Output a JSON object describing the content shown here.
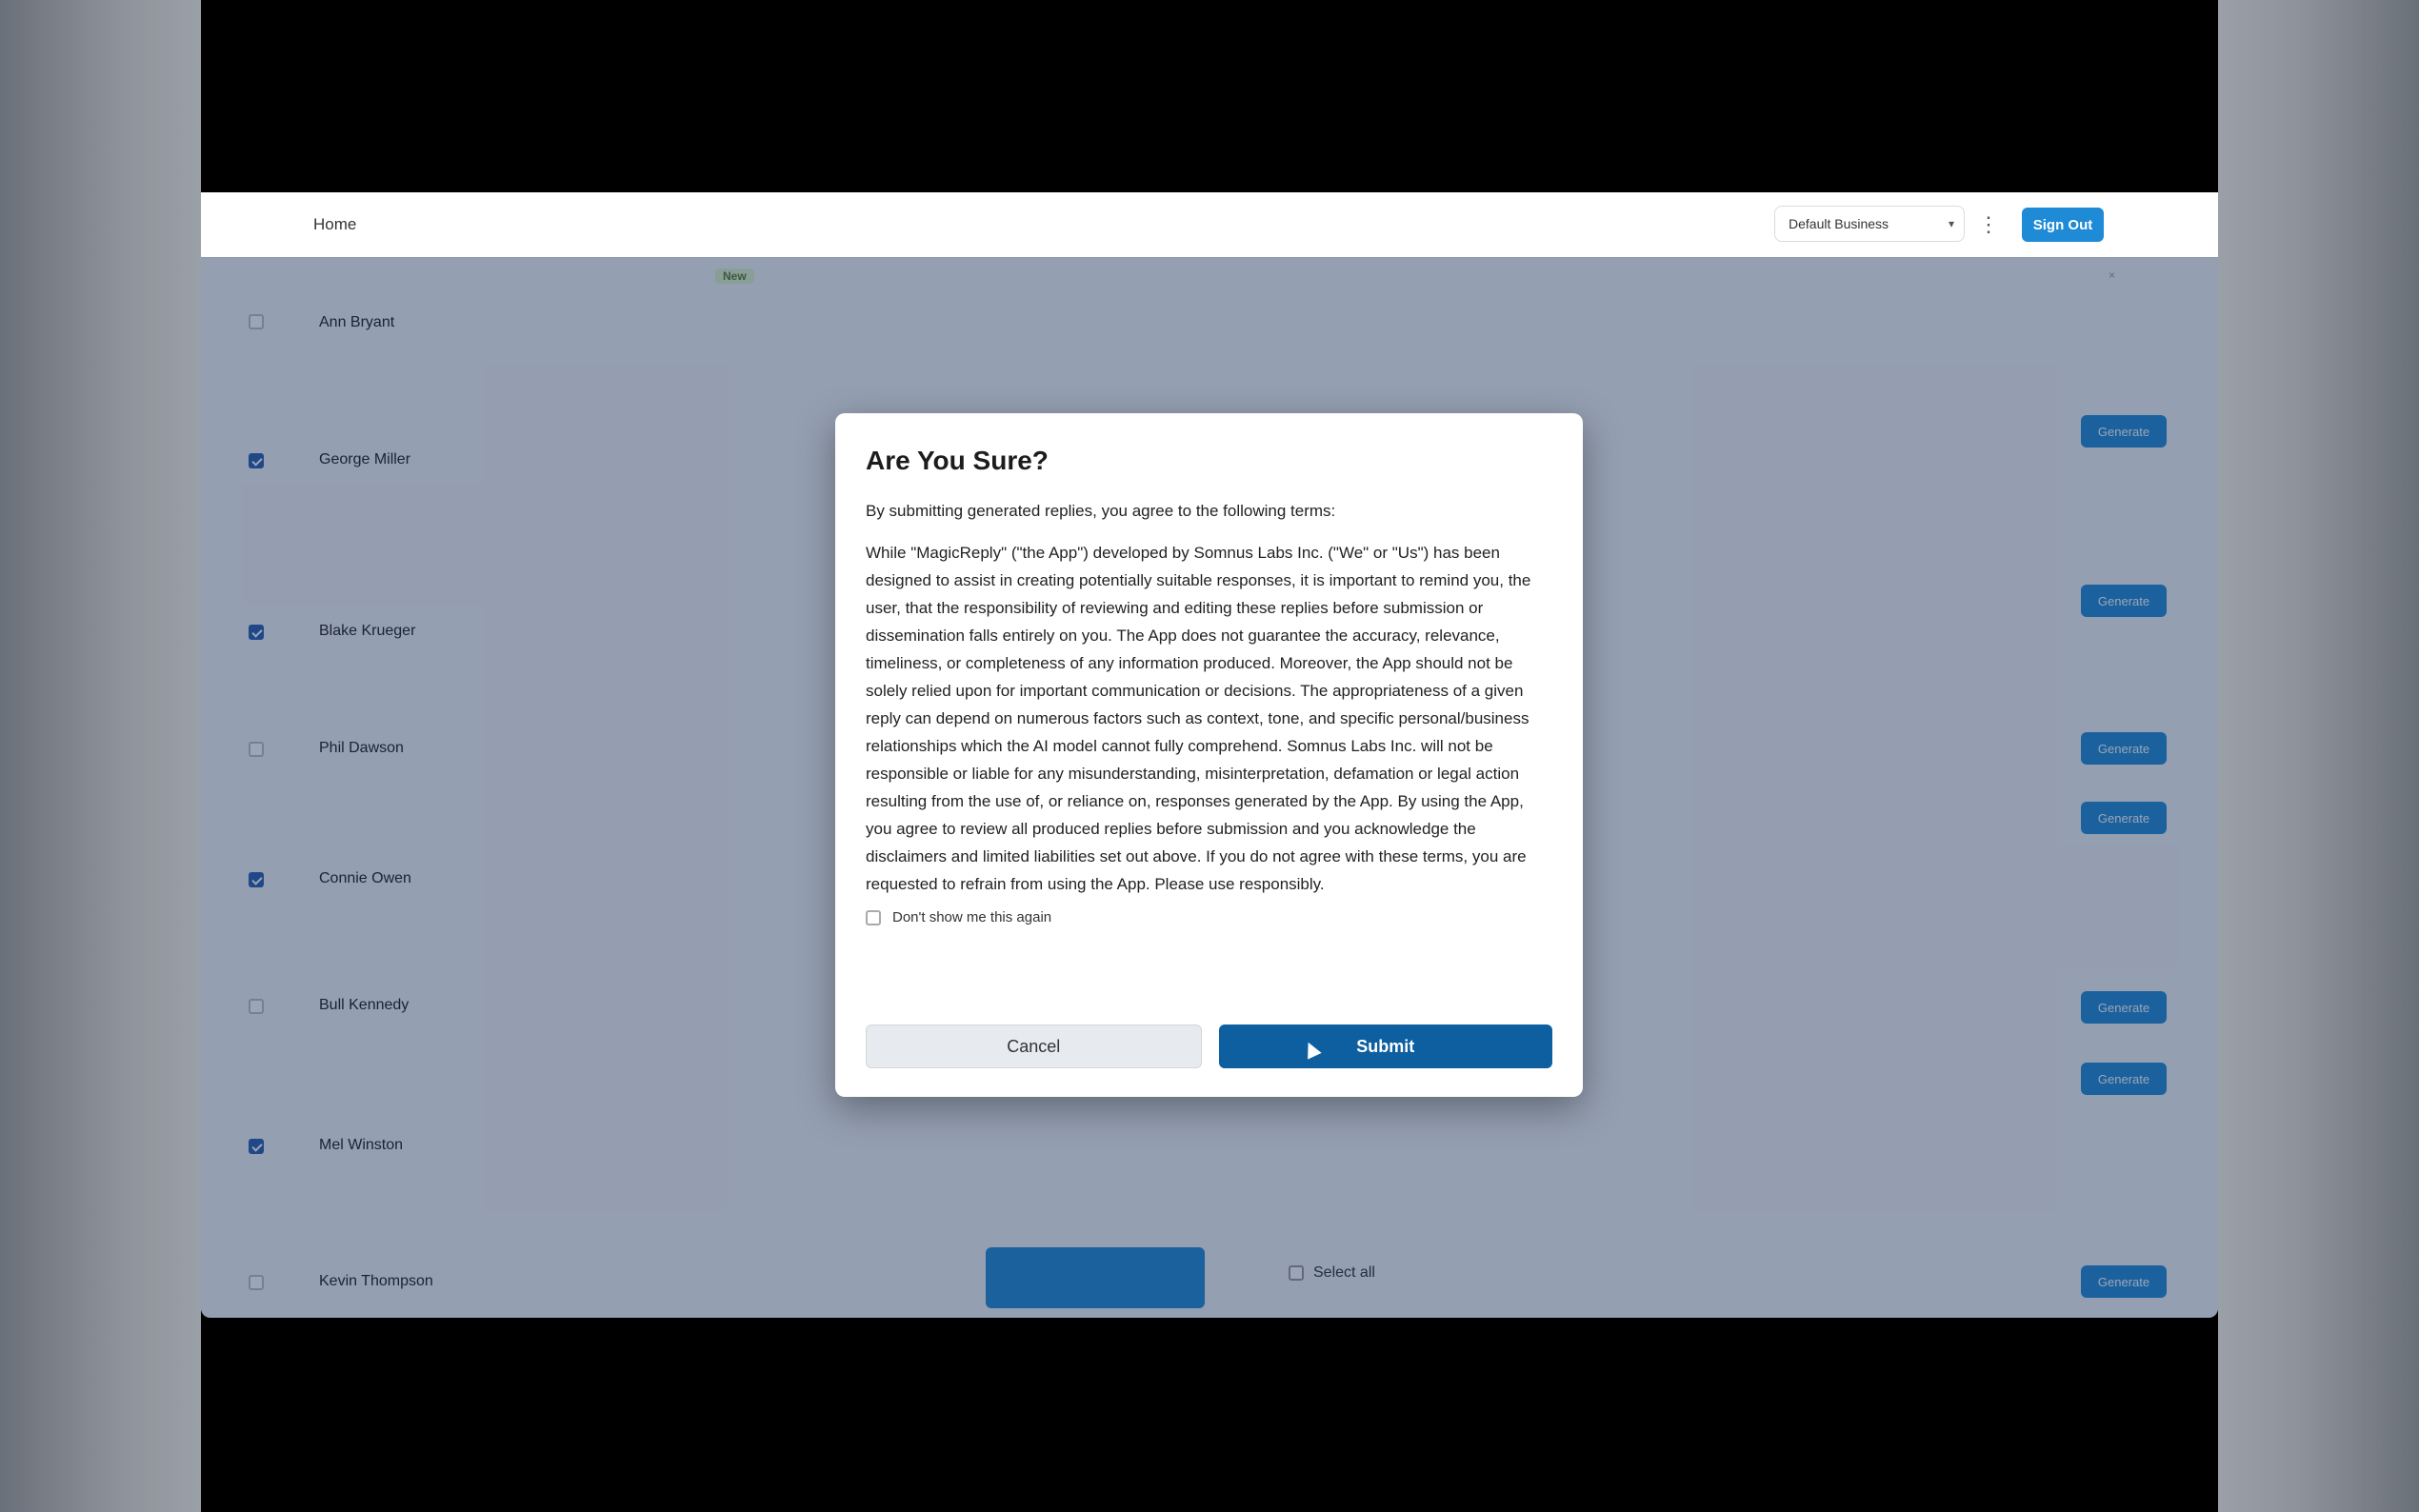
{
  "topbar": {
    "home_label": "Home",
    "business_select": "Default Business",
    "more_icon": "ellipsis-vertical-icon",
    "signout_label": "Sign Out"
  },
  "banner": {
    "pill": "New",
    "text": "",
    "close": "×"
  },
  "rows": [
    {
      "name": "Ann Bryant",
      "checked": false,
      "review": "",
      "reply": "",
      "tag": "",
      "button": ""
    },
    {
      "name": "George Miller",
      "checked": true,
      "review": "",
      "reply": "",
      "button": "Generate"
    },
    {
      "name": "Blake Krueger",
      "checked": true,
      "review": "",
      "reply": "",
      "button": "Generate"
    },
    {
      "name": "Phil Dawson",
      "checked": false,
      "review": "",
      "reply": "",
      "button": "Generate"
    },
    {
      "name": "Connie Owen",
      "checked": true,
      "review": "",
      "reply": "",
      "button": "Generate"
    },
    {
      "name": "Bull Kennedy",
      "checked": false,
      "review": "",
      "reply": "",
      "button": "Generate"
    },
    {
      "name": "Mel Winston",
      "checked": true,
      "review": "",
      "reply": "",
      "button": "Generate"
    },
    {
      "name": "Kevin Thompson",
      "checked": false,
      "review": "",
      "reply": "",
      "button": "Generate"
    }
  ],
  "bottom": {
    "action_label": "",
    "select_all_label": "Select all"
  },
  "modal": {
    "title": "Are You Sure?",
    "intro": "By submitting generated replies, you agree to the following terms:",
    "terms": "While \"MagicReply\" (\"the App\") developed by Somnus Labs Inc. (\"We\" or \"Us\") has been designed to assist in creating potentially suitable responses, it is important to remind you, the user, that the responsibility of reviewing and editing these replies before submission or dissemination falls entirely on you. The App does not guarantee the accuracy, relevance, timeliness, or completeness of any information produced. Moreover, the App should not be solely relied upon for important communication or decisions. The appropriateness of a given reply can depend on numerous factors such as context, tone, and specific personal/business relationships which the AI model cannot fully comprehend. Somnus Labs Inc. will not be responsible or liable for any misunderstanding, misinterpretation, defamation or legal action resulting from the use of, or reliance on, responses generated by the App. By using the App, you agree to review all produced replies before submission and you acknowledge the disclaimers and limited liabilities set out above. If you do not agree with these terms, you are requested to refrain from using the App. Please use responsibly.",
    "dont_show": "Don't show me this again",
    "cancel_label": "Cancel",
    "submit_label": "Submit"
  }
}
